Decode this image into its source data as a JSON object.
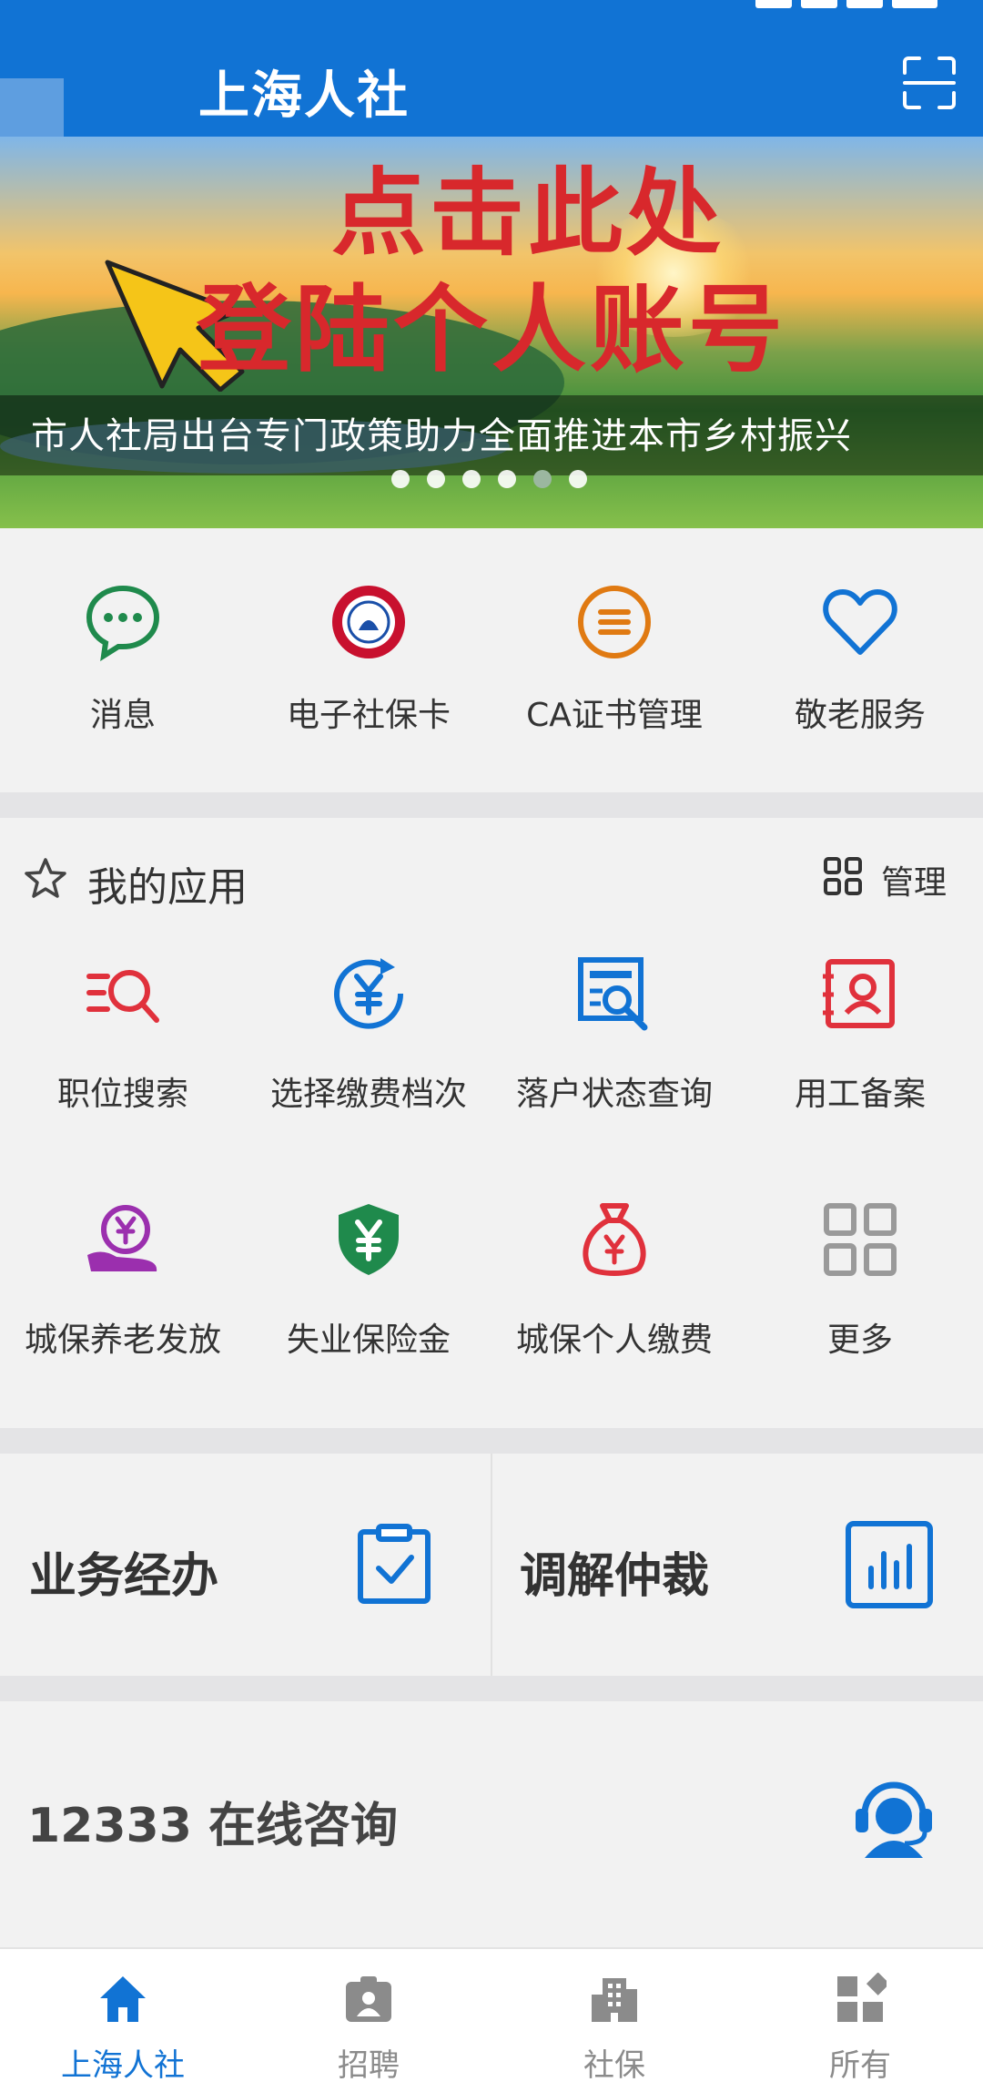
{
  "header": {
    "title": "上海人社"
  },
  "banner": {
    "headline_line1": "点击此处",
    "headline_line2": "登陆个人账号",
    "caption": "市人社局出台专门政策助力全面推进本市乡村振兴",
    "slide_count": 6,
    "active_slide": 5
  },
  "quick_actions": [
    {
      "label": "消息",
      "icon": "message-icon",
      "color": "#1f8a4c"
    },
    {
      "label": "电子社保卡",
      "icon": "social-security-card-icon",
      "color": "#c8102e"
    },
    {
      "label": "CA证书管理",
      "icon": "certificate-icon",
      "color": "#e07a12"
    },
    {
      "label": "敬老服务",
      "icon": "heart-icon",
      "color": "#1173d4"
    }
  ],
  "my_apps": {
    "title": "我的应用",
    "manage_label": "管理",
    "items": [
      {
        "label": "职位搜索",
        "icon": "job-search-icon",
        "color": "#e0313c"
      },
      {
        "label": "选择缴费档次",
        "icon": "yuan-refresh-icon",
        "color": "#1173d4"
      },
      {
        "label": "落户状态查询",
        "icon": "document-search-icon",
        "color": "#1173d4"
      },
      {
        "label": "用工备案",
        "icon": "employee-record-icon",
        "color": "#e0313c"
      },
      {
        "label": "城保养老发放",
        "icon": "yuan-hand-icon",
        "color": "#9b2fae"
      },
      {
        "label": "失业保险金",
        "icon": "yuan-shield-icon",
        "color": "#1f8a4c"
      },
      {
        "label": "城保个人缴费",
        "icon": "money-bag-icon",
        "color": "#e0313c"
      },
      {
        "label": "更多",
        "icon": "more-grid-icon",
        "color": "#9a9a9a"
      }
    ]
  },
  "business": {
    "left_label": "业务经办",
    "right_label": "调解仲裁"
  },
  "consult": {
    "label": "12333 在线咨询"
  },
  "tabbar": [
    {
      "label": "上海人社",
      "icon": "home-icon",
      "active": true
    },
    {
      "label": "招聘",
      "icon": "recruit-badge-icon",
      "active": false
    },
    {
      "label": "社保",
      "icon": "building-icon",
      "active": false
    },
    {
      "label": "所有",
      "icon": "all-apps-icon",
      "active": false
    }
  ],
  "colors": {
    "brand": "#1173d4",
    "active_tab": "#1173d4",
    "inactive_tab": "#8b8b8b",
    "banner_text": "#d8282c"
  }
}
